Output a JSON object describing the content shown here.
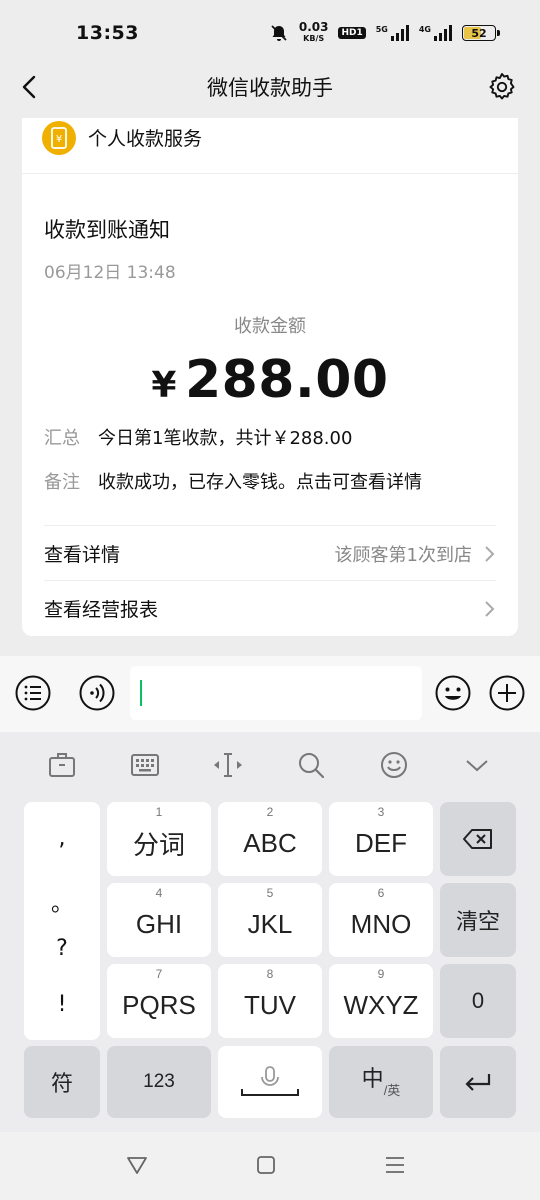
{
  "status_bar": {
    "time": "13:53",
    "net_speed": "0.03",
    "net_speed_unit": "KB/S",
    "hd_badge": "HD1",
    "sig1_label": "5G",
    "sig2_label": "4G",
    "battery": "52"
  },
  "nav": {
    "title": "微信收款助手"
  },
  "card": {
    "service_name": "个人收款服务",
    "notice_title": "收款到账通知",
    "notice_time": "06月12日 13:48",
    "amount_label": "收款金额",
    "currency": "¥",
    "amount": "288.00",
    "summary_key": "汇总",
    "summary_value": "今日第1笔收款，共计￥288.00",
    "remark_key": "备注",
    "remark_value": "收款成功，已存入零钱。点击可查看详情",
    "row1_label": "查看详情",
    "row1_hint": "该顾客第1次到店",
    "row2_label": "查看经营报表"
  },
  "keyboard": {
    "keys": [
      {
        "num": "1",
        "label": "分词"
      },
      {
        "num": "2",
        "label": "ABC"
      },
      {
        "num": "3",
        "label": "DEF"
      },
      {
        "num": "4",
        "label": "GHI"
      },
      {
        "num": "5",
        "label": "JKL"
      },
      {
        "num": "6",
        "label": "MNO"
      },
      {
        "num": "7",
        "label": "PQRS"
      },
      {
        "num": "8",
        "label": "TUV"
      },
      {
        "num": "9",
        "label": "WXYZ"
      }
    ],
    "punct": [
      ",",
      "。",
      "?",
      "!"
    ],
    "clear": "清空",
    "zero": "0",
    "symbols": "符",
    "num_mode": "123",
    "lang_main": "中",
    "lang_sub": "/英"
  },
  "colors": {
    "accent_green": "#07c160",
    "coin_yellow": "#f0b000"
  }
}
